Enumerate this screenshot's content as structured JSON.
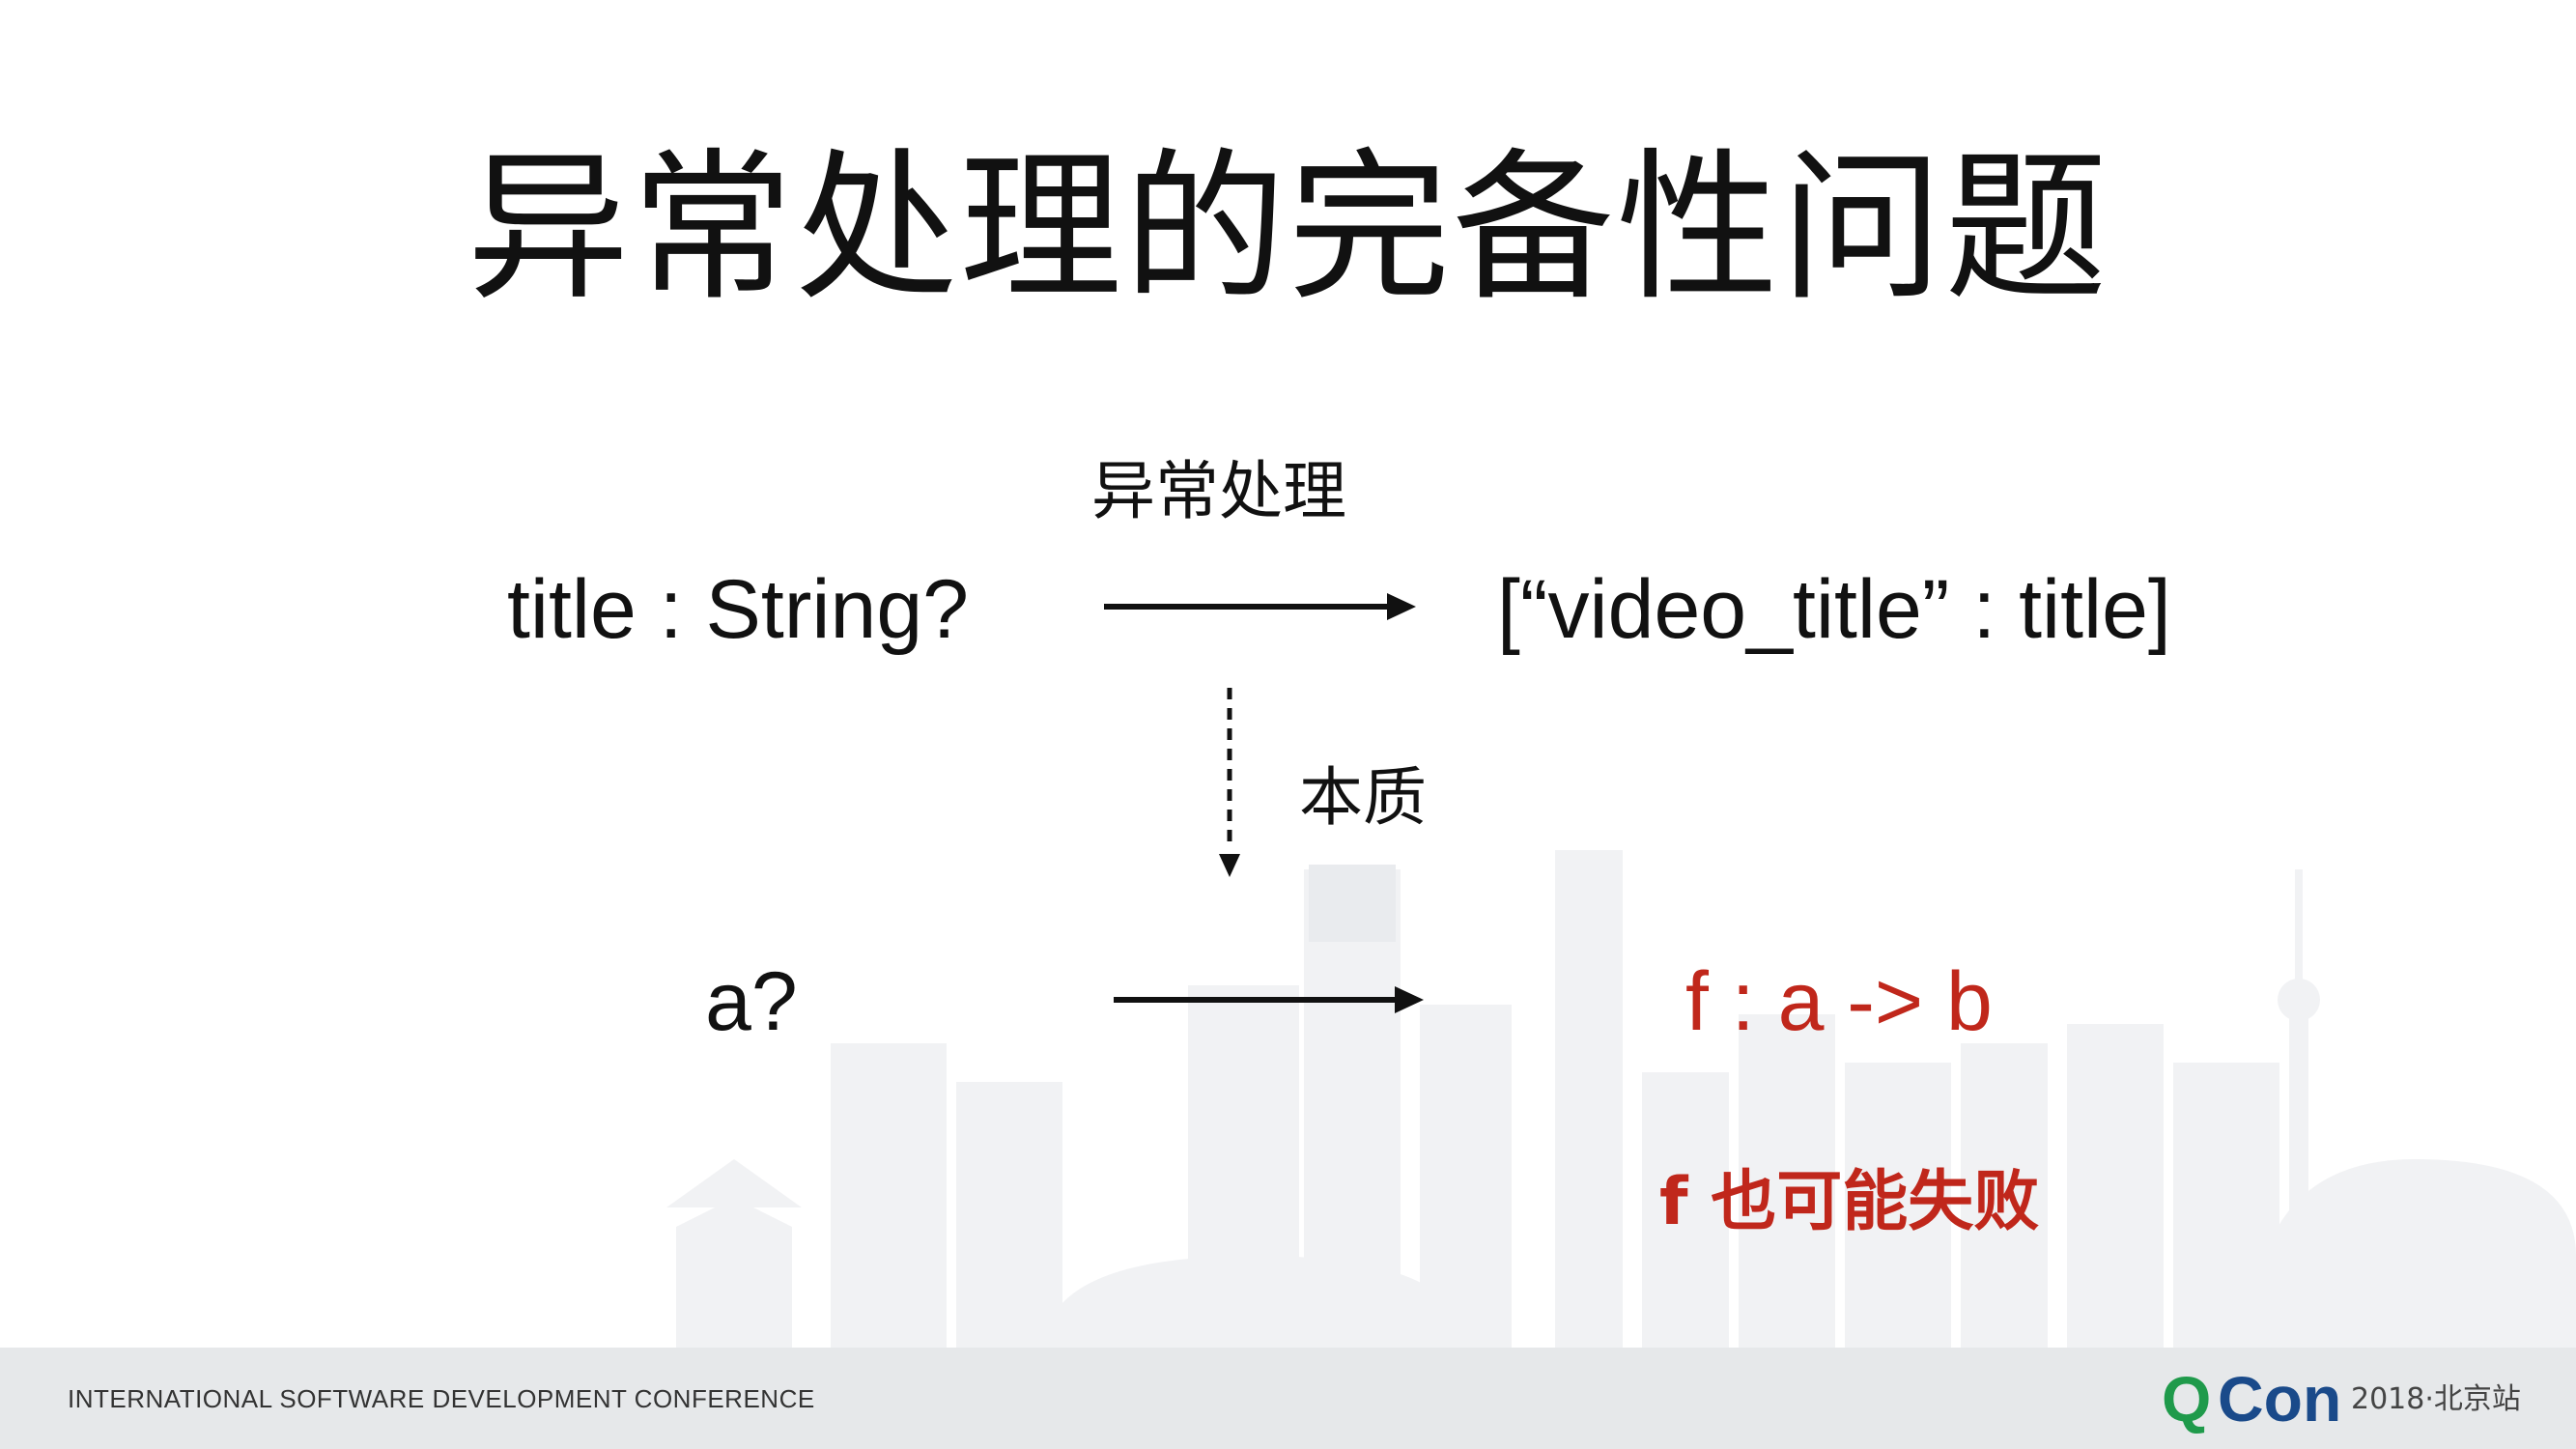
{
  "slide": {
    "title": "异常处理的完备性问题",
    "top_label": "异常处理",
    "source_type": "title : String?",
    "target_dict": "[“video_title” : title]",
    "essence_label": "本质",
    "optional_a": "a?",
    "function_signature": "f : a -> b",
    "failure_note": "f 也可能失败"
  },
  "footer": {
    "conference_name": "INTERNATIONAL SOFTWARE DEVELOPMENT CONFERENCE",
    "brand_q": "Q",
    "brand_con": "Con",
    "edition": "2018·北京站"
  },
  "colors": {
    "accent_red": "#c0271b",
    "text": "#111111",
    "footer_bg": "#e6e8ea",
    "brand_green": "#1f9a4b",
    "brand_blue": "#1a4a8a"
  }
}
